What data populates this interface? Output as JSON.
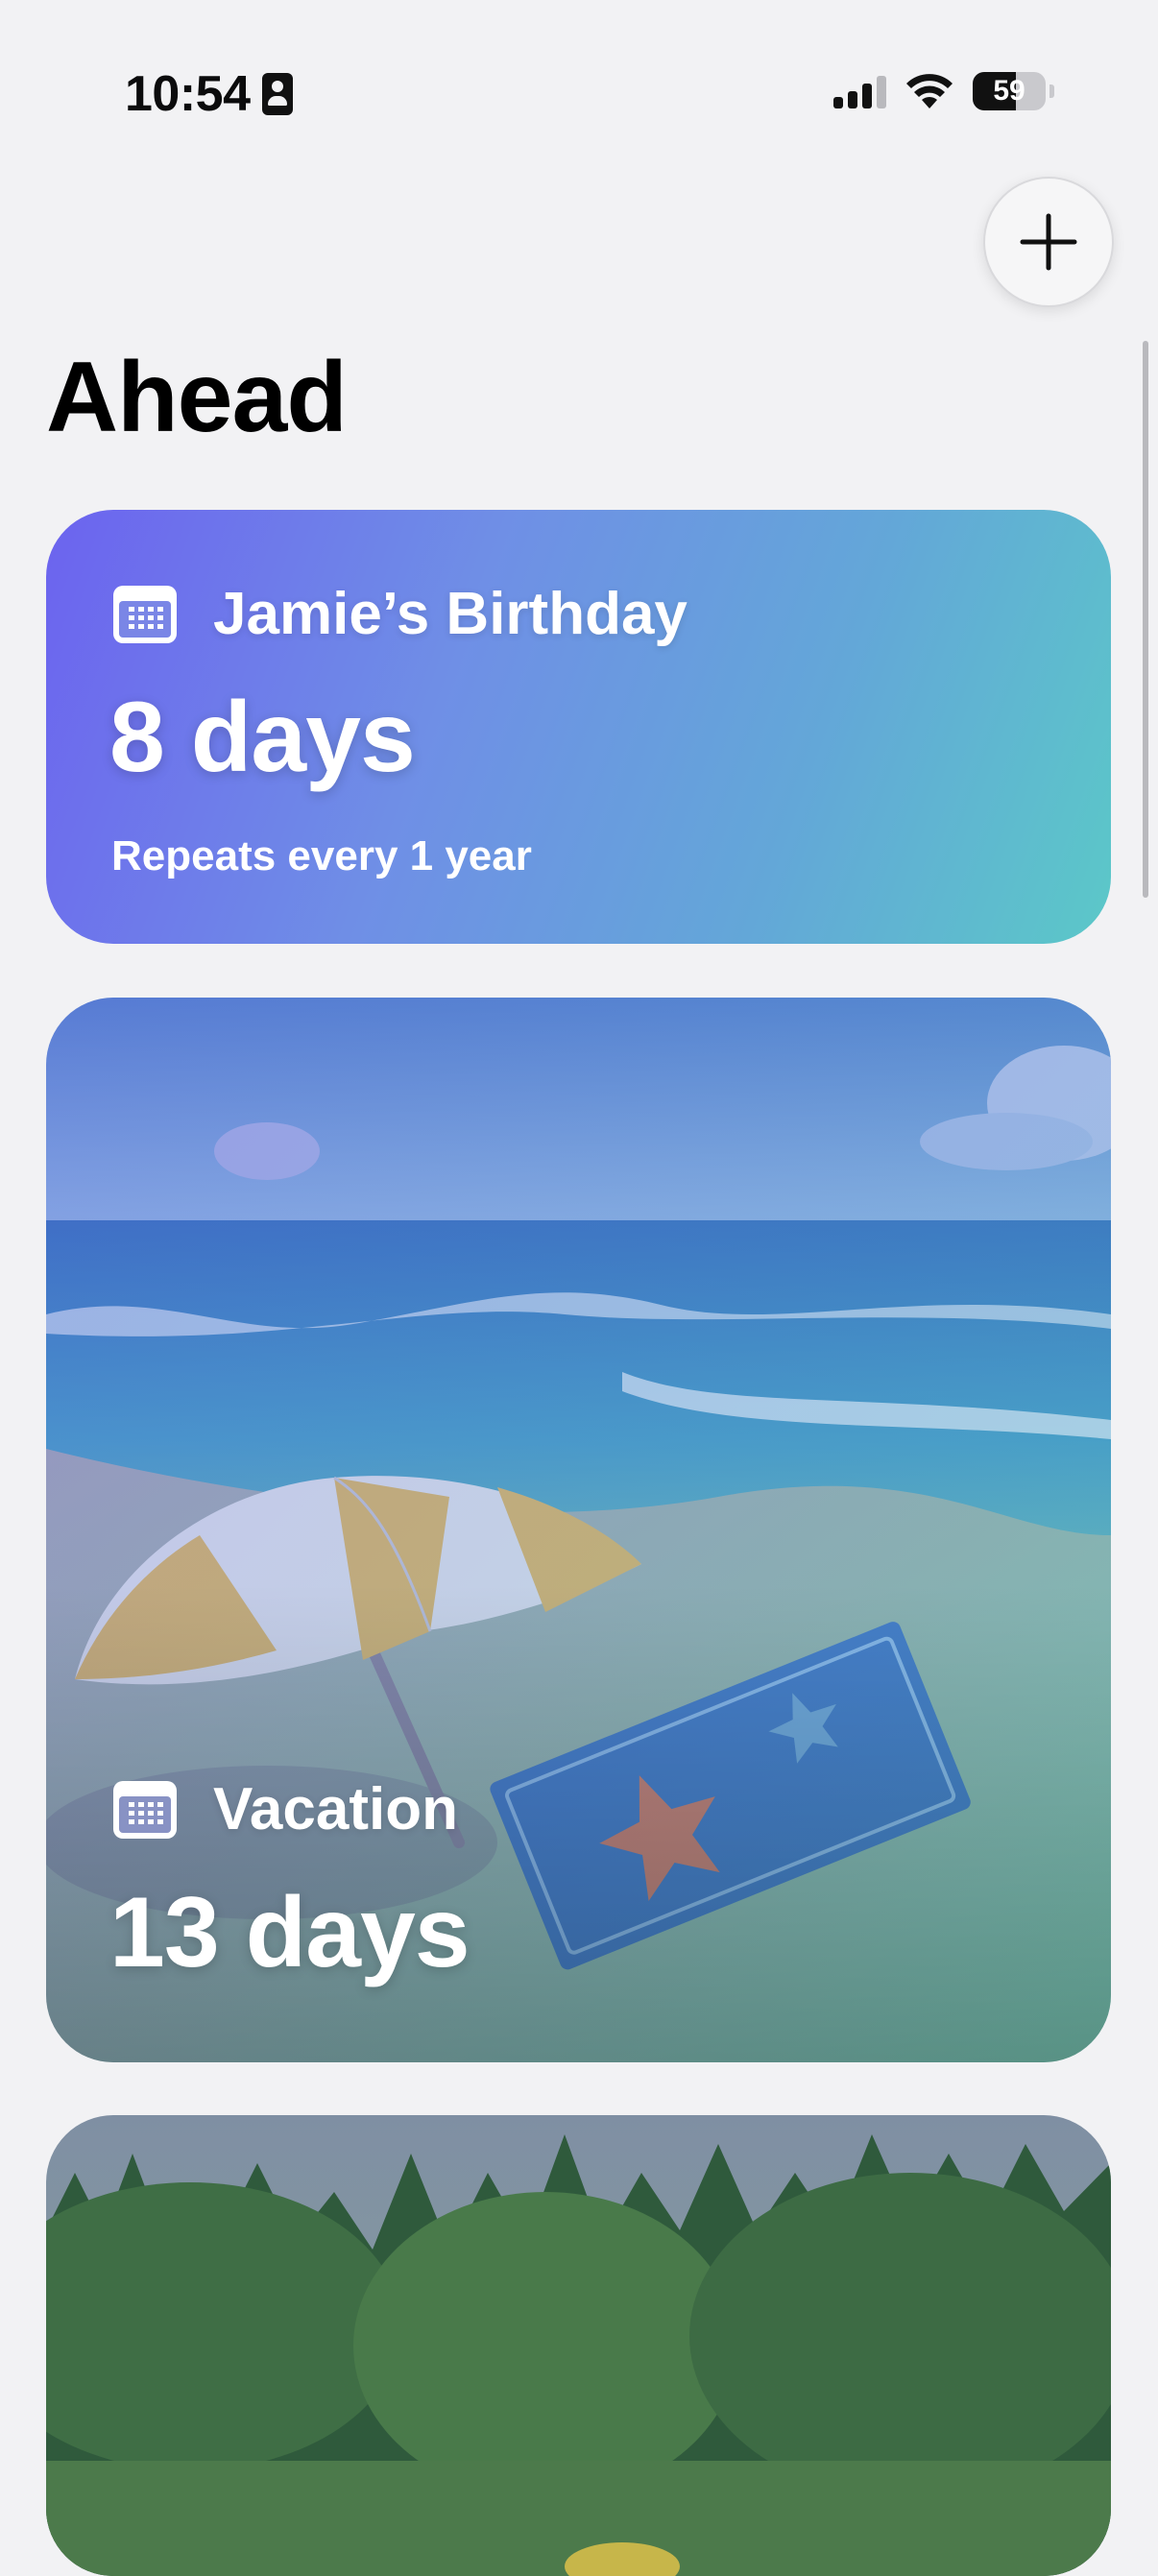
{
  "status_bar": {
    "time": "10:54",
    "battery": "59",
    "battery_level": 0.59,
    "icons": [
      "id-card-icon",
      "cellular-signal-icon",
      "wifi-icon",
      "battery-icon"
    ]
  },
  "header": {
    "title": "Ahead",
    "add_icon": "plus-icon"
  },
  "events": [
    {
      "title": "Jamie’s Birthday",
      "count": "8 days",
      "subtitle": "Repeats every 1 year",
      "icon": "calendar-icon",
      "background": "gradient",
      "colors": [
        "#6c63ef",
        "#5bc8c8"
      ]
    },
    {
      "title": "Vacation",
      "count": "13 days",
      "icon": "calendar-icon",
      "background": "beach-image"
    },
    {
      "background": "forest-image"
    }
  ]
}
